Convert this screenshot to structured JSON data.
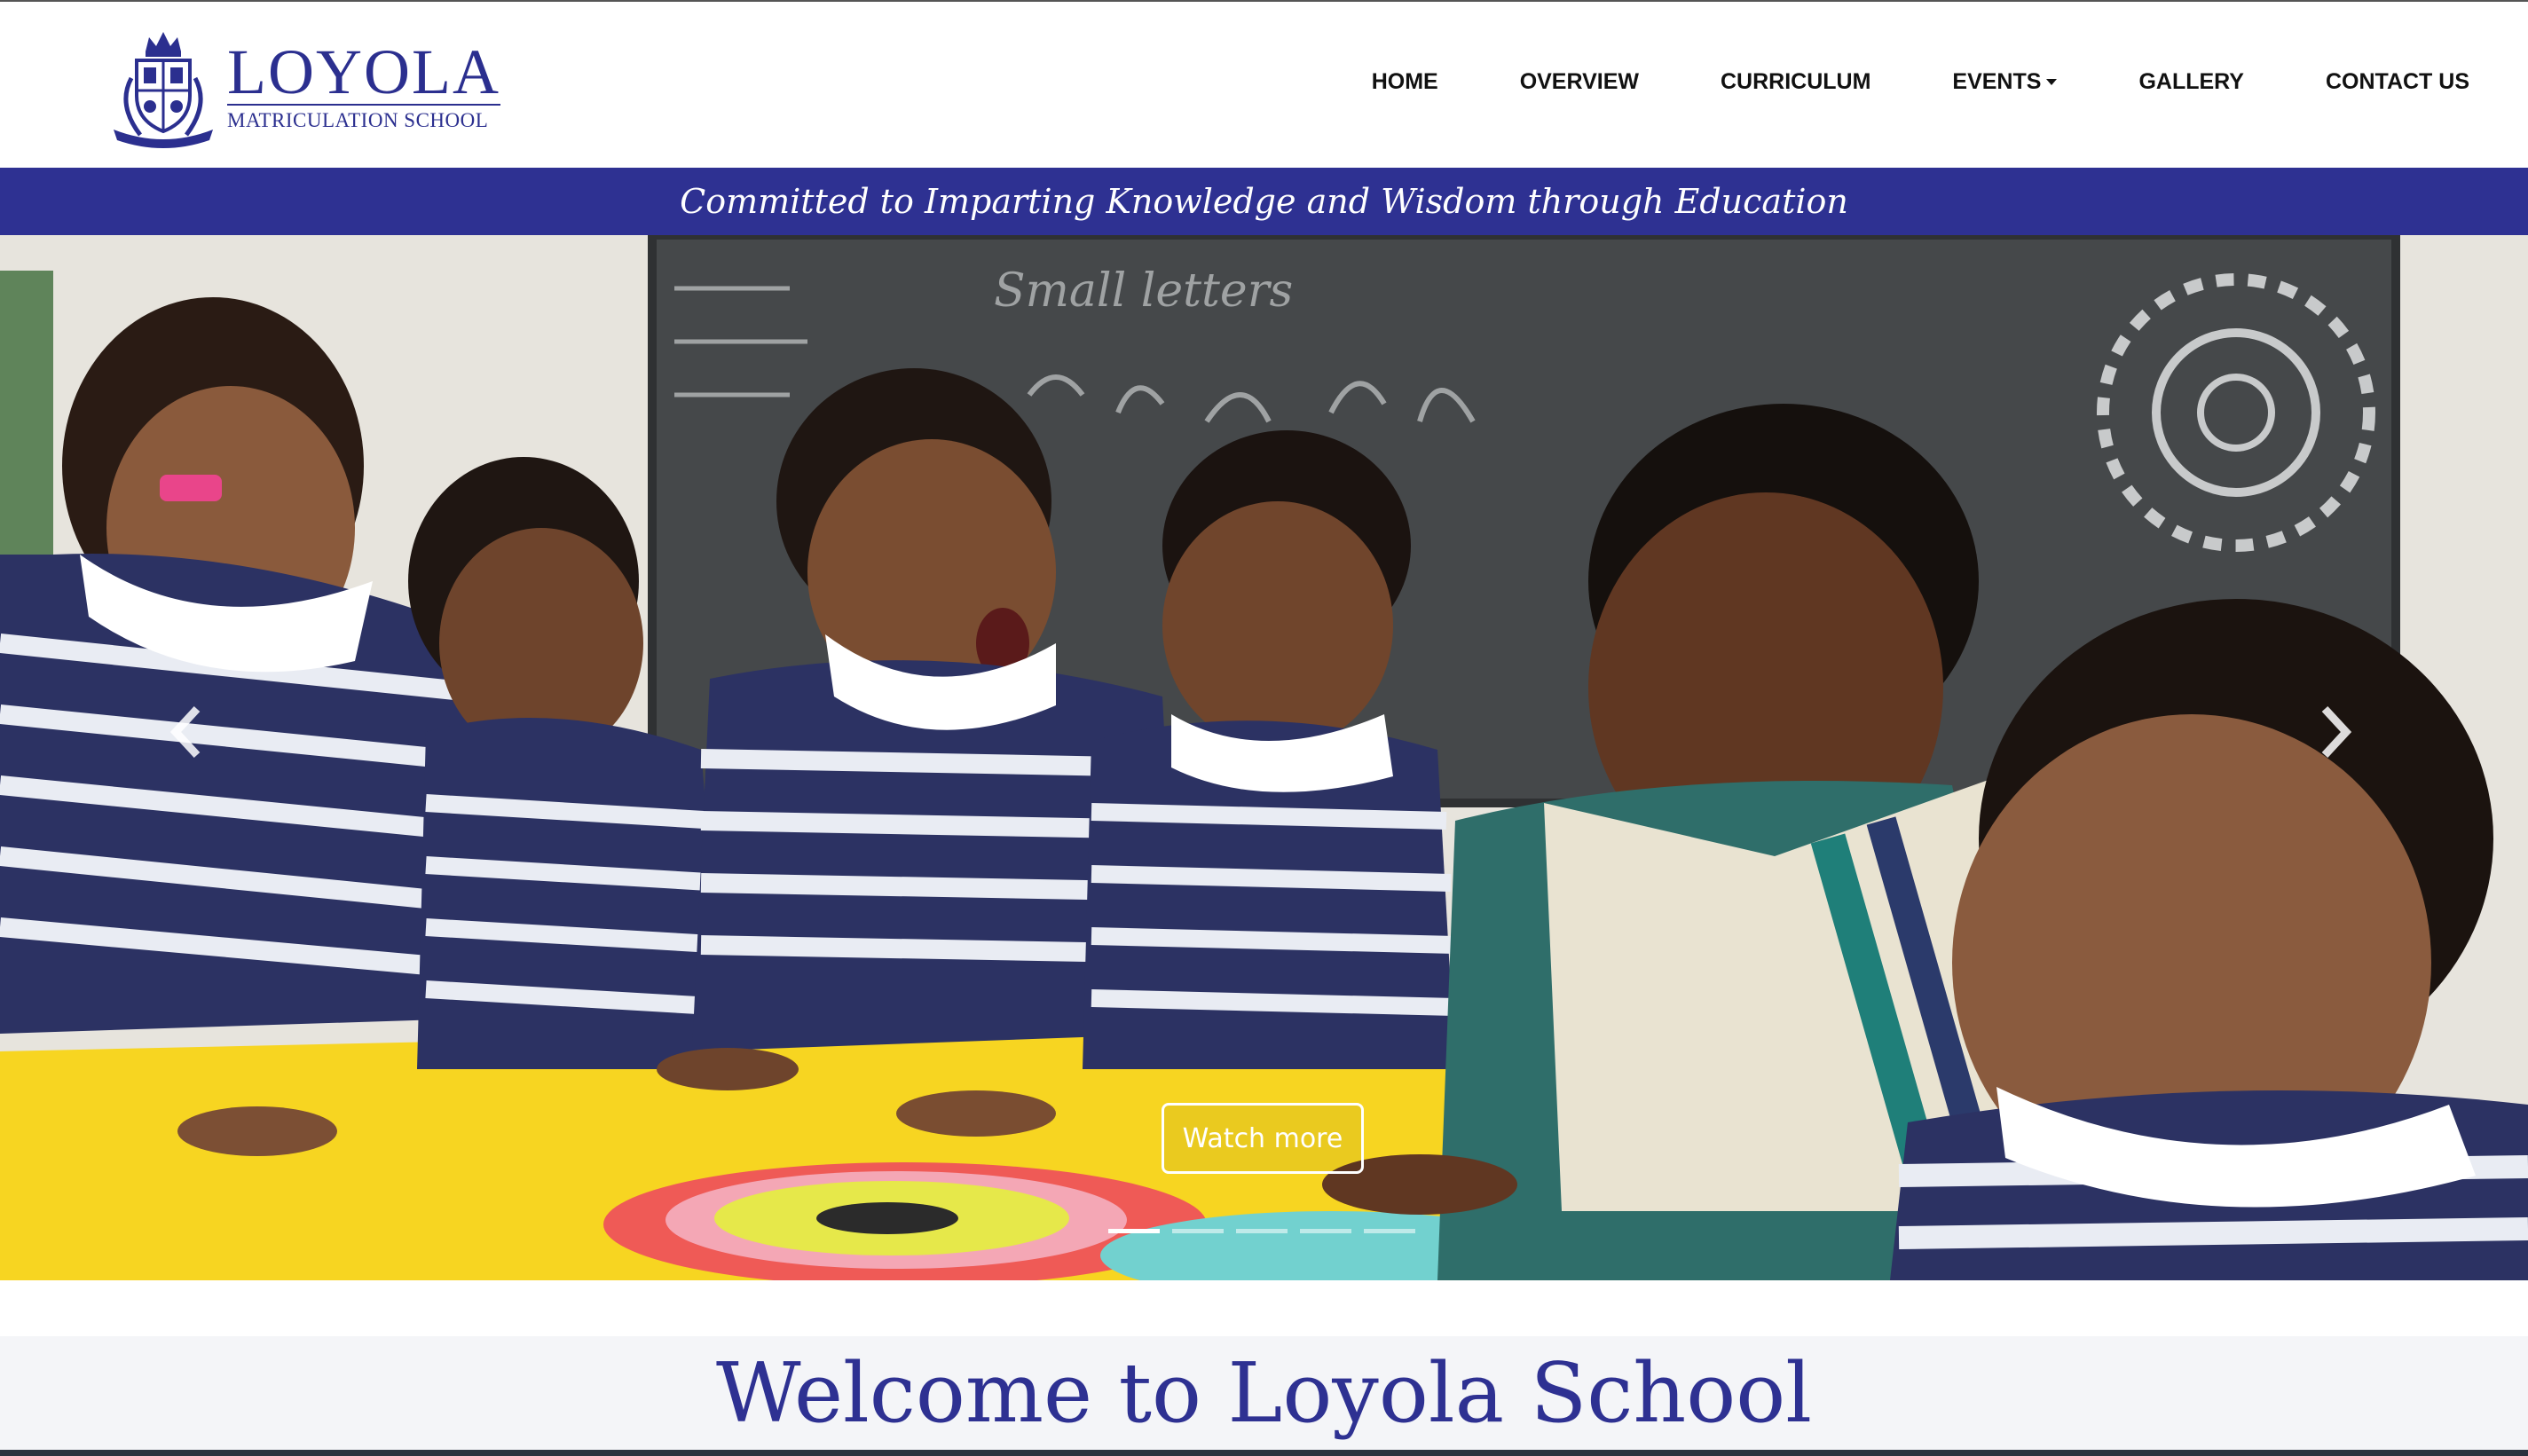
{
  "brand": {
    "name": "LOYOLA",
    "subtitle": "MATRICULATION SCHOOL"
  },
  "nav": {
    "items": [
      {
        "label": "HOME"
      },
      {
        "label": "OVERVIEW"
      },
      {
        "label": "CURRICULUM"
      },
      {
        "label": "EVENTS"
      },
      {
        "label": "GALLERY"
      },
      {
        "label": "CONTACT US"
      }
    ]
  },
  "tagline": "Committed to Imparting Knowledge and Wisdom through Education",
  "hero": {
    "button_label": "Watch more",
    "slides_count": 5,
    "active_slide": 1,
    "prev_icon": "chevron-left-icon",
    "next_icon": "chevron-right-icon",
    "blackboard_text": "Small letters"
  },
  "welcome": {
    "heading": "Welcome to Loyola School"
  },
  "colors": {
    "brand_blue": "#2e3192",
    "logo_blue": "#2b2f8f",
    "table_yellow": "#f7d21c",
    "welcome_bg": "#f4f5f8"
  }
}
